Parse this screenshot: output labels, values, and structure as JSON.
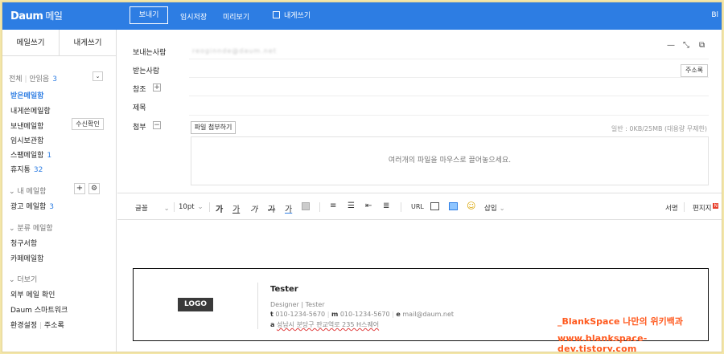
{
  "topbar": {
    "logo": "Daum",
    "service": "메일",
    "send": "보내기",
    "save_draft": "임시저장",
    "preview": "미리보기",
    "self_send": "내게쓰기",
    "right_text": "Bl"
  },
  "sidebar": {
    "tabs": [
      "메일쓰기",
      "내게쓰기"
    ],
    "all": "전체",
    "unread": "안읽음",
    "unread_count": "3",
    "folders": [
      {
        "label": "받은메일함",
        "active": true
      },
      {
        "label": "내게쓴메일함"
      },
      {
        "label": "보낸메일함",
        "button": "수신확인"
      },
      {
        "label": "임시보관함"
      },
      {
        "label": "스팸메일함",
        "count": "1"
      },
      {
        "label": "휴지통",
        "count": "32"
      }
    ],
    "my_section": "내 메일함",
    "my_items": [
      {
        "label": "광고 메일함",
        "count": "3"
      }
    ],
    "category_section": "분류 메일함",
    "category_items": [
      "청구서함",
      "카페메일함"
    ],
    "more_section": "더보기",
    "more_items": [
      "외부 메일 확인",
      "Daum 스마트워크"
    ],
    "settings": "환경설정",
    "address_book": "주소록"
  },
  "compose": {
    "from_label": "보내는사람",
    "from_value": "reoginnde@daum.net",
    "to_label": "받는사람",
    "address_book_btn": "주소록",
    "cc_label": "참조",
    "subject_label": "제목",
    "attach_label": "첨부",
    "attach_btn": "파일 첨부하기",
    "attach_info": "일반 : 0KB/25MB (대용량 무제한)",
    "dropzone_text": "여러개의 파일을 마우스로 끌어놓으세요."
  },
  "toolbar": {
    "font": "글꼴",
    "size": "10pt",
    "bold": "가",
    "underline": "가",
    "italic": "가",
    "strike": "가",
    "color": "가",
    "url": "URL",
    "insert": "삽입",
    "signature": "서명",
    "stationery": "편지지",
    "new_badge": "N"
  },
  "signature": {
    "logo": "LOGO",
    "name": "Tester",
    "title_line": "Designer  |  Tester",
    "t_label": "t",
    "t_value": "010-1234-5670",
    "m_label": "m",
    "m_value": "010-1234-5670",
    "e_label": "e",
    "e_value": "mail@daum.net",
    "a_label": "a",
    "a_value": "성남시 분당구 판교역로 235 H스퀘어"
  },
  "watermark": {
    "line1": "_BlankSpace 나만의 위키백과",
    "line2": "www.blankspace-dev.tistory.com"
  }
}
